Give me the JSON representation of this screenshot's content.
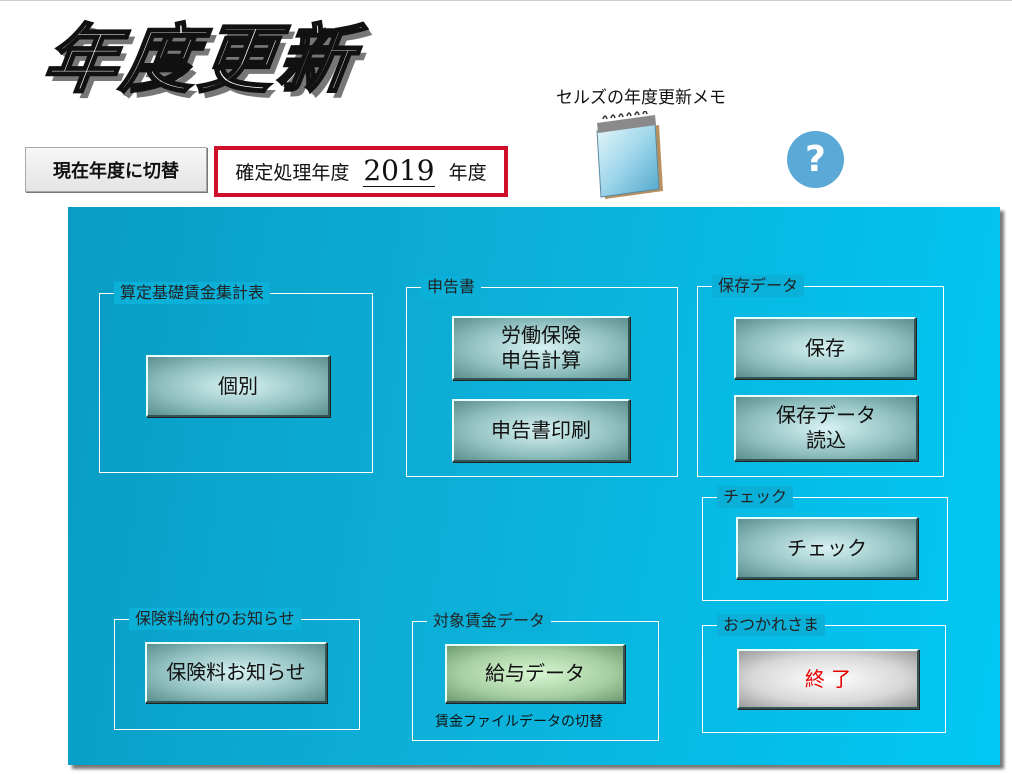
{
  "header": {
    "title": "年度更新",
    "switch_button": "現在年度に切替",
    "fiscal_label": "確定処理年度",
    "fiscal_year": "2019",
    "fiscal_suffix": "年度",
    "memo_label": "セルズの年度更新メモ",
    "help_symbol": "?"
  },
  "groups": {
    "santei": {
      "label": "算定基礎賃金集計表",
      "individual_button": "個別"
    },
    "shinkoku": {
      "label": "申告書",
      "calc_button_line1": "労働保険",
      "calc_button_line2": "申告計算",
      "print_button": "申告書印刷"
    },
    "hozon": {
      "label": "保存データ",
      "save_button": "保存",
      "load_button_line1": "保存データ",
      "load_button_line2": "読込"
    },
    "check": {
      "label": "チェック",
      "check_button": "チェック"
    },
    "hokenryo": {
      "label": "保険料納付のお知らせ",
      "notice_button": "保険料お知らせ"
    },
    "chingin": {
      "label": "対象賃金データ",
      "salary_button": "給与データ",
      "note": "賃金ファイルデータの切替"
    },
    "otsukare": {
      "label": "おつかれさま",
      "exit_button": "終 了"
    }
  },
  "colors": {
    "panel": "#0cb0d8",
    "accent_border": "#d0102a",
    "help": "#5aa9d6",
    "exit_text": "#e60000"
  },
  "icons": {
    "memo": "notepad-icon",
    "help": "help-icon"
  }
}
